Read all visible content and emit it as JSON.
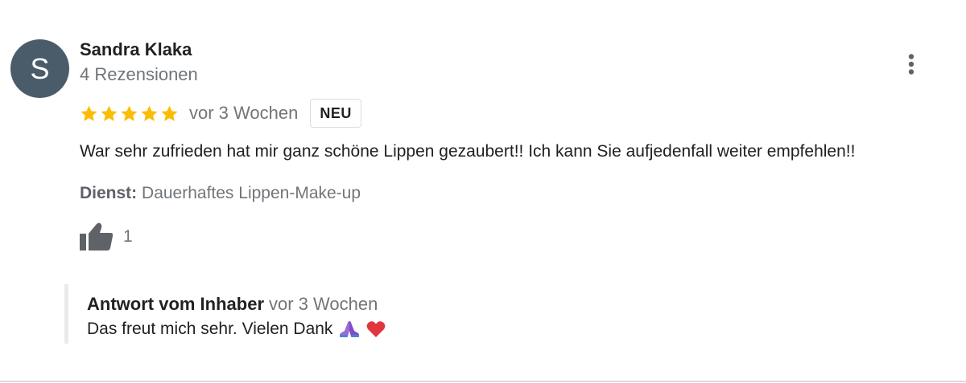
{
  "review": {
    "author": {
      "avatar_initial": "S",
      "avatar_color": "#4a5b6a",
      "name": "Sandra Klaka",
      "meta": "4 Rezensionen"
    },
    "rating": 5,
    "rating_color": "#fbbc04",
    "time": "vor 3 Wochen",
    "badge": "NEU",
    "text": "War sehr zufrieden hat mir ganz schöne Lippen gezaubert!! Ich kann Sie aufjedenfall weiter empfehlen!!",
    "service_label": "Dienst:",
    "service_value": "Dauerhaftes Lippen-Make-up",
    "likes": "1",
    "icons": {
      "more": "more-vert-icon",
      "like": "thumbs-up-icon",
      "star": "star-icon"
    }
  },
  "owner_reply": {
    "title": "Antwort vom Inhaber",
    "time": "vor 3 Wochen",
    "text": "Das freut mich sehr. Vielen Dank",
    "emojis": [
      "folded-hands-emoji",
      "red-heart-emoji"
    ]
  }
}
